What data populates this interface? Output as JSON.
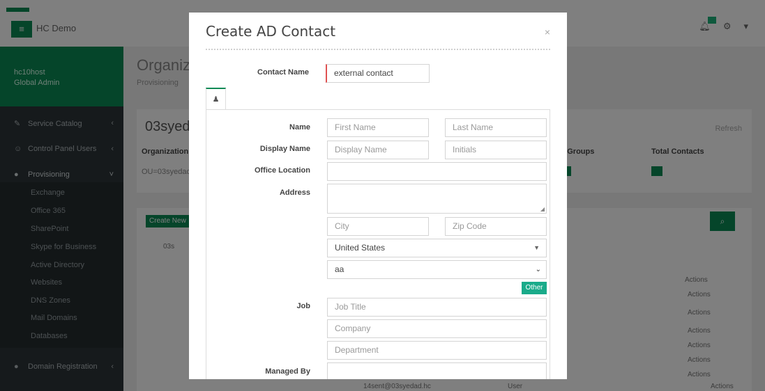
{
  "background": {
    "brand": "HC Demo",
    "user": {
      "name": "hc10host",
      "role": "Global Admin"
    },
    "sidebar": [
      {
        "label": "Service Catalog"
      },
      {
        "label": "Control Panel Users"
      },
      {
        "label": "Provisioning"
      },
      {
        "label": "Domain Registration"
      }
    ],
    "provisioning_items": [
      "Exchange",
      "Office 365",
      "SharePoint",
      "Skype for Business",
      "Active Directory",
      "Websites",
      "DNS Zones",
      "Mail Domains",
      "Databases"
    ],
    "page_title": "Organiza",
    "breadcrumb": "Provisioning",
    "panel_title": "03syed",
    "refresh": "Refresh",
    "columns": [
      "Organization",
      "al Groups",
      "Total Contacts"
    ],
    "row_cell": "OU=03syedad",
    "create_new": "Create New",
    "tree_item": "03s",
    "actions": [
      "Actions",
      "Actions",
      "Actions",
      "Actions",
      "Actions",
      "Actions",
      "Actions",
      "Actions"
    ],
    "bottom_row": {
      "email": "14sent@03syedad.hc",
      "type": "User"
    }
  },
  "modal": {
    "title": "Create AD Contact",
    "close": "×",
    "contact_name": {
      "label": "Contact Name",
      "value": "external contact"
    },
    "tab_icon": "user-icon",
    "labels": {
      "name": "Name",
      "display_name": "Display Name",
      "office_location": "Office Location",
      "address": "Address",
      "job": "Job",
      "managed_by": "Managed By"
    },
    "placeholders": {
      "first_name": "First Name",
      "last_name": "Last Name",
      "display_name": "Display Name",
      "initials": "Initials",
      "city": "City",
      "zip": "Zip Code",
      "job_title": "Job Title",
      "company": "Company",
      "department": "Department"
    },
    "country": "United States",
    "state": "aa",
    "other_button": "Other"
  },
  "colors": {
    "accent": "#0b8a55",
    "other_button": "#1aab8a",
    "required_border": "#e05252"
  }
}
